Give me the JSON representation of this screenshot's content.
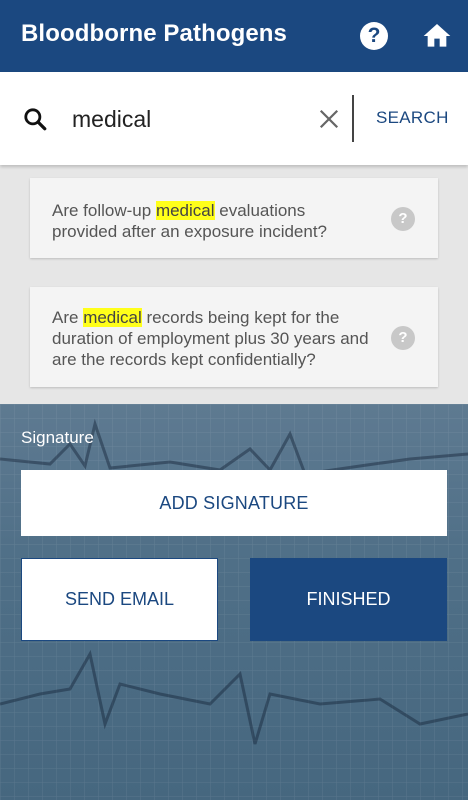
{
  "header": {
    "title": "Bloodborne Pathogens",
    "help_icon": "question-circle-icon",
    "home_icon": "home-icon",
    "background": "#1b4880"
  },
  "search": {
    "value": "medical",
    "button_label": "SEARCH",
    "search_icon": "search-icon",
    "clear_icon": "close-icon"
  },
  "results": [
    {
      "before": "Are follow-up ",
      "highlight": "medical",
      "after": " evaluations provided after an exposure incident?",
      "help_mark": "?"
    },
    {
      "before": "Are ",
      "highlight": "medical",
      "after": " records being kept for the duration of employment plus 30 years and are the records kept confidentially?",
      "help_mark": "?"
    }
  ],
  "signature": {
    "label": "Signature",
    "add_button": "ADD SIGNATURE"
  },
  "actions": {
    "send_email": "SEND EMAIL",
    "finished": "FINISHED"
  },
  "colors": {
    "accent": "#1b4880",
    "highlight": "#ffff1a"
  }
}
